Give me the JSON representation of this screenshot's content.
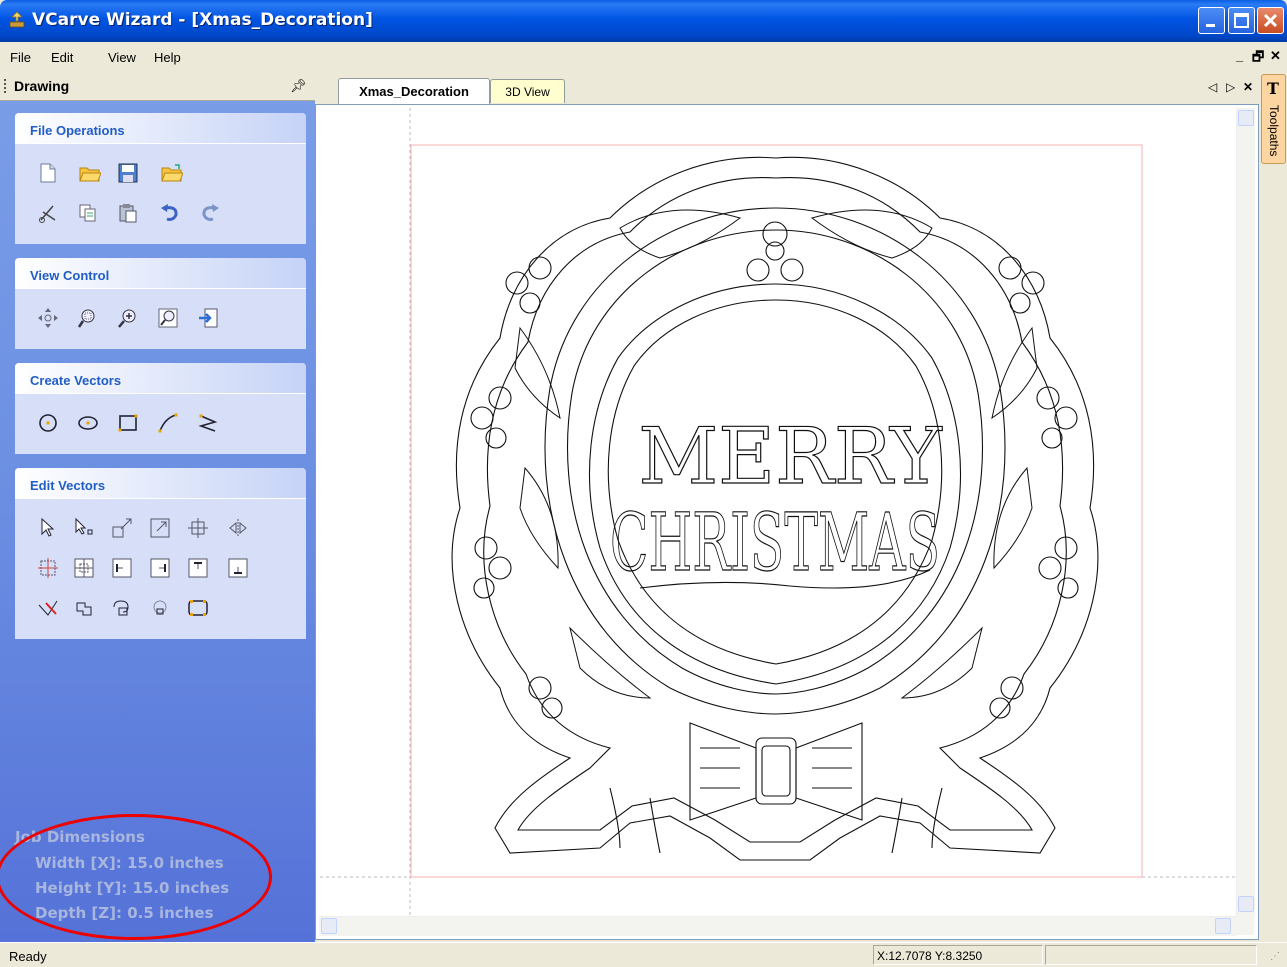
{
  "window": {
    "title": "VCarve Wizard - [Xmas_Decoration]"
  },
  "menu": {
    "items": [
      "File",
      "Edit",
      "View",
      "Help"
    ]
  },
  "panel": {
    "title": "Drawing",
    "sections": [
      {
        "title": "File Operations"
      },
      {
        "title": "View Control"
      },
      {
        "title": "Create Vectors"
      },
      {
        "title": "Edit Vectors"
      }
    ],
    "job_dimensions": {
      "heading": "Job Dimensions",
      "width": "Width  [X]: 15.0 inches",
      "height": "Height [Y]: 15.0 inches",
      "depth": "Depth  [Z]: 0.5 inches"
    }
  },
  "tabs": [
    {
      "label": "Xmas_Decoration",
      "active": true
    },
    {
      "label": "3D View",
      "active": false
    }
  ],
  "canvas": {
    "text_line1": "MERRY",
    "text_line2": "CHRISTMAS"
  },
  "right_tab": {
    "label": "Toolpaths"
  },
  "status": {
    "text": "Ready",
    "coords": "X:12.7078 Y:8.3250"
  },
  "colors": {
    "titlebar": "#0054e3",
    "panel_bg": "#6b8ee2",
    "section_header": "#215dc6",
    "highlight_oval": "#e00000",
    "material_border": "#f4b0b0"
  }
}
